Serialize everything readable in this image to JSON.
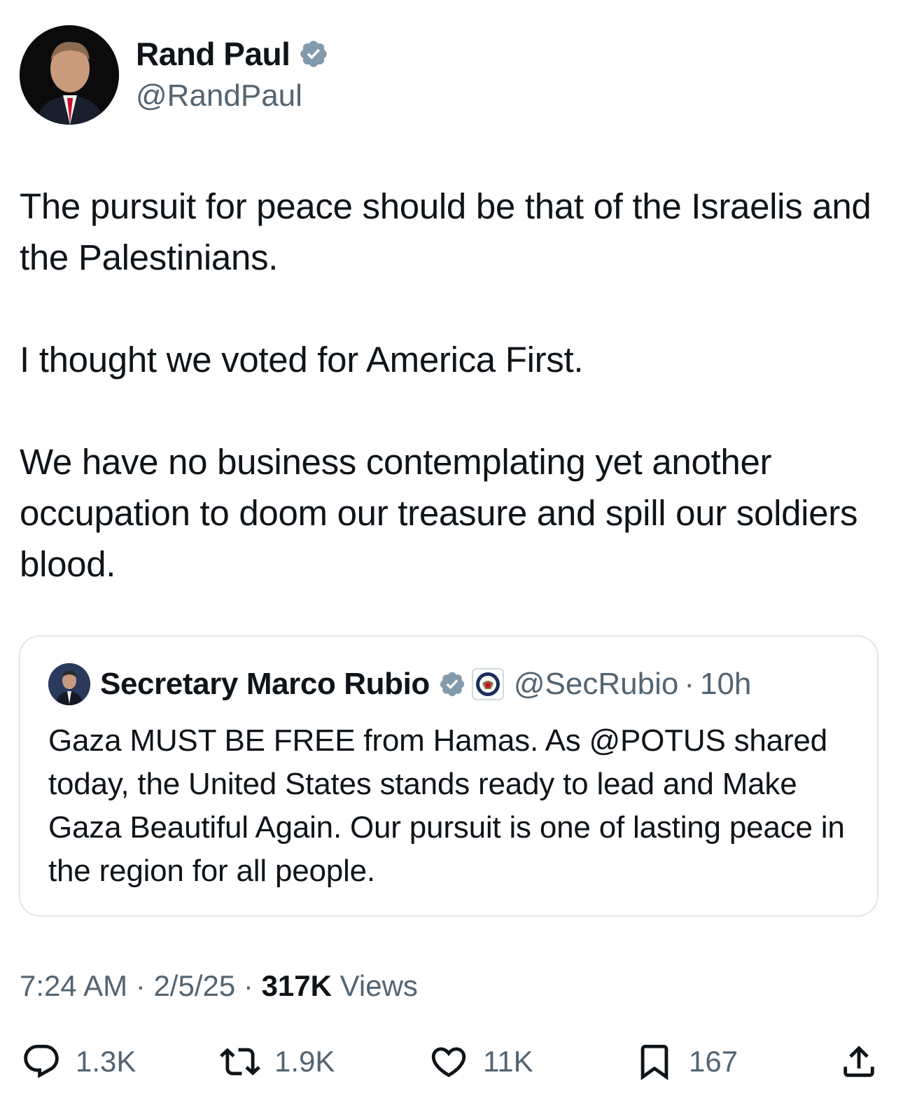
{
  "author": {
    "name": "Rand Paul",
    "handle": "@RandPaul",
    "verified": true
  },
  "tweet": {
    "paragraphs": [
      "The pursuit for peace should be that of the Israelis and the Palestinians.",
      "I thought we voted for America First.",
      "We have no business contemplating yet another occupation to doom our treasure and spill our soldiers blood."
    ]
  },
  "quoted": {
    "name": "Secretary Marco Rubio",
    "handle": "@SecRubio",
    "separator": "·",
    "time": "10h",
    "text": "Gaza MUST BE FREE from Hamas. As @POTUS shared today, the United States stands ready to lead and Make Gaza Beautiful Again. Our pursuit is one of lasting peace in the region for all people."
  },
  "meta": {
    "time": "7:24 AM",
    "sep1": "·",
    "date": "2/5/25",
    "sep2": "·",
    "views_count": "317K",
    "views_label": "Views"
  },
  "actions": {
    "replies": "1.3K",
    "reposts": "1.9K",
    "likes": "11K",
    "bookmarks": "167"
  },
  "colors": {
    "text": "#0f1419",
    "secondary": "#536471",
    "verified_badge": "#829aab",
    "border": "#e1e6ea"
  },
  "icons": [
    "verified-badge-icon",
    "government-seal-icon",
    "reply-icon",
    "repost-icon",
    "like-icon",
    "bookmark-icon",
    "share-icon"
  ]
}
